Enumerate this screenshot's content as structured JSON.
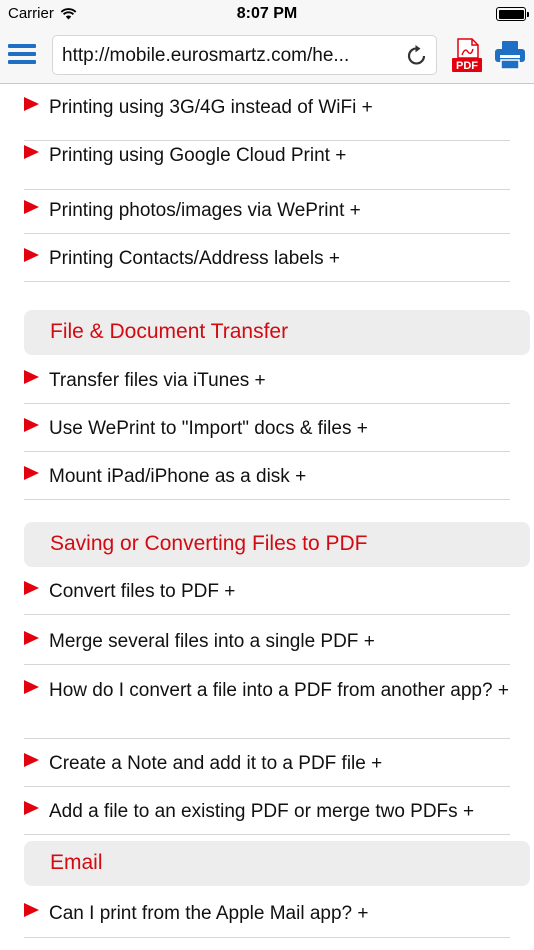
{
  "status_bar": {
    "carrier": "Carrier",
    "time": "8:07 PM"
  },
  "toolbar": {
    "url": "http://mobile.eurosmartz.com/he...",
    "pdf_label": "PDF"
  },
  "colors": {
    "accent_red": "#e3000f",
    "toolbar_blue": "#1f6fc5"
  },
  "groups": [
    {
      "items": [
        "Printing using 3G/4G instead of WiFi +",
        "Printing using Google Cloud Print +",
        "Printing photos/images via WePrint +",
        "Printing Contacts/Address labels +"
      ]
    },
    {
      "section": "File & Document Transfer",
      "items": [
        "Transfer files via iTunes +",
        "Use WePrint to \"Import\" docs & files +",
        "Mount iPad/iPhone as a disk +"
      ]
    },
    {
      "section": "Saving or Converting Files to PDF",
      "items": [
        "Convert files to PDF +",
        "Merge several files into a single PDF +",
        "How do I convert a file into a PDF from another app? +",
        "Create a Note and add it to a PDF file +",
        "Add a file to an existing PDF or merge two PDFs +"
      ]
    },
    {
      "section": "Email",
      "items": [
        "Can I print from the Apple Mail app? +"
      ]
    }
  ]
}
